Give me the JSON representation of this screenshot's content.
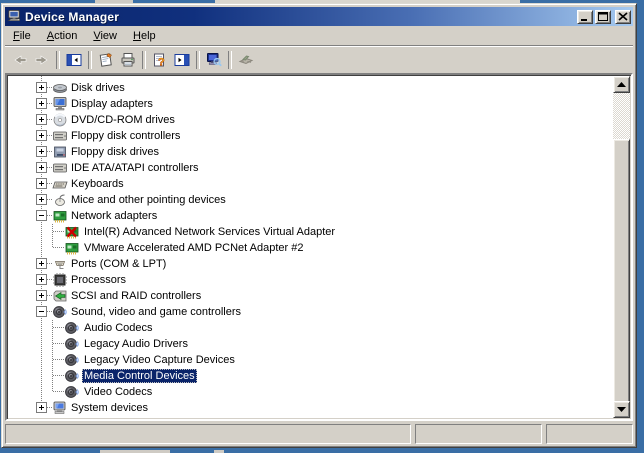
{
  "window": {
    "title": "Device Manager",
    "title_icon": "computer-icon",
    "title_buttons": [
      {
        "name": "minimize",
        "icon": "minimize-icon"
      },
      {
        "name": "maximize",
        "icon": "maximize-icon"
      },
      {
        "name": "close",
        "icon": "close-icon"
      }
    ]
  },
  "colors": {
    "title_gradient_start": "#0a246a",
    "title_gradient_end": "#a6caf0",
    "window_face": "#d4d0c8",
    "selection": "#0a246a",
    "desktop": "#3a6ea5",
    "tree_background": "#ffffff"
  },
  "menu": {
    "items": [
      {
        "label": "File",
        "underline_index": 0
      },
      {
        "label": "Action",
        "underline_index": 0
      },
      {
        "label": "View",
        "underline_index": 0
      },
      {
        "label": "Help",
        "underline_index": 0
      }
    ]
  },
  "toolbar": {
    "buttons": [
      {
        "name": "back",
        "icon": "back-arrow-icon",
        "disabled": true
      },
      {
        "name": "forward",
        "icon": "forward-arrow-icon",
        "disabled": true
      },
      {
        "sep": true
      },
      {
        "name": "show-hide-console-tree",
        "icon": "pane-left-icon",
        "disabled": false
      },
      {
        "sep": true
      },
      {
        "name": "properties",
        "icon": "properties-icon",
        "disabled": false
      },
      {
        "name": "print",
        "icon": "print-icon",
        "disabled": false
      },
      {
        "sep": true
      },
      {
        "name": "help",
        "icon": "help-icon",
        "disabled": false
      },
      {
        "name": "show-hide-action-pane",
        "icon": "pane-right-icon",
        "disabled": false
      },
      {
        "sep": true
      },
      {
        "name": "scan-for-hardware-changes",
        "icon": "scan-icon",
        "disabled": false
      },
      {
        "sep": true
      },
      {
        "name": "driver",
        "icon": "driver-icon",
        "disabled": true
      }
    ]
  },
  "tree": {
    "items": [
      {
        "label": "Disk drives",
        "level": 1,
        "expand": "+",
        "icon": "disk-drive-icon"
      },
      {
        "label": "Display adapters",
        "level": 1,
        "expand": "+",
        "icon": "display-adapter-icon"
      },
      {
        "label": "DVD/CD-ROM drives",
        "level": 1,
        "expand": "+",
        "icon": "cd-drive-icon"
      },
      {
        "label": "Floppy disk controllers",
        "level": 1,
        "expand": "+",
        "icon": "controller-icon"
      },
      {
        "label": "Floppy disk drives",
        "level": 1,
        "expand": "+",
        "icon": "floppy-drive-icon"
      },
      {
        "label": "IDE ATA/ATAPI controllers",
        "level": 1,
        "expand": "+",
        "icon": "controller-icon"
      },
      {
        "label": "Keyboards",
        "level": 1,
        "expand": "+",
        "icon": "keyboard-icon"
      },
      {
        "label": "Mice and other pointing devices",
        "level": 1,
        "expand": "+",
        "icon": "mouse-icon"
      },
      {
        "label": "Network adapters",
        "level": 1,
        "expand": "-",
        "icon": "network-card-icon"
      },
      {
        "label": "Intel(R) Advanced Network Services Virtual Adapter",
        "level": 2,
        "icon": "network-card-error-icon"
      },
      {
        "label": "VMware Accelerated AMD PCNet Adapter #2",
        "level": 2,
        "icon": "network-card-icon",
        "last_child": true
      },
      {
        "label": "Ports (COM & LPT)",
        "level": 1,
        "expand": "+",
        "icon": "port-icon"
      },
      {
        "label": "Processors",
        "level": 1,
        "expand": "+",
        "icon": "processor-icon"
      },
      {
        "label": "SCSI and RAID controllers",
        "level": 1,
        "expand": "+",
        "icon": "scsi-icon"
      },
      {
        "label": "Sound, video and game controllers",
        "level": 1,
        "expand": "-",
        "icon": "sound-icon"
      },
      {
        "label": "Audio Codecs",
        "level": 2,
        "icon": "sound-icon"
      },
      {
        "label": "Legacy Audio Drivers",
        "level": 2,
        "icon": "sound-icon"
      },
      {
        "label": "Legacy Video Capture Devices",
        "level": 2,
        "icon": "sound-icon"
      },
      {
        "label": "Media Control Devices",
        "level": 2,
        "icon": "sound-icon",
        "selected": true
      },
      {
        "label": "Video Codecs",
        "level": 2,
        "icon": "sound-icon",
        "last_child": true
      },
      {
        "label": "System devices",
        "level": 1,
        "expand": "+",
        "icon": "system-icon",
        "last_root": true
      }
    ]
  },
  "status_bar": {
    "panels": [
      "",
      "",
      ""
    ]
  }
}
